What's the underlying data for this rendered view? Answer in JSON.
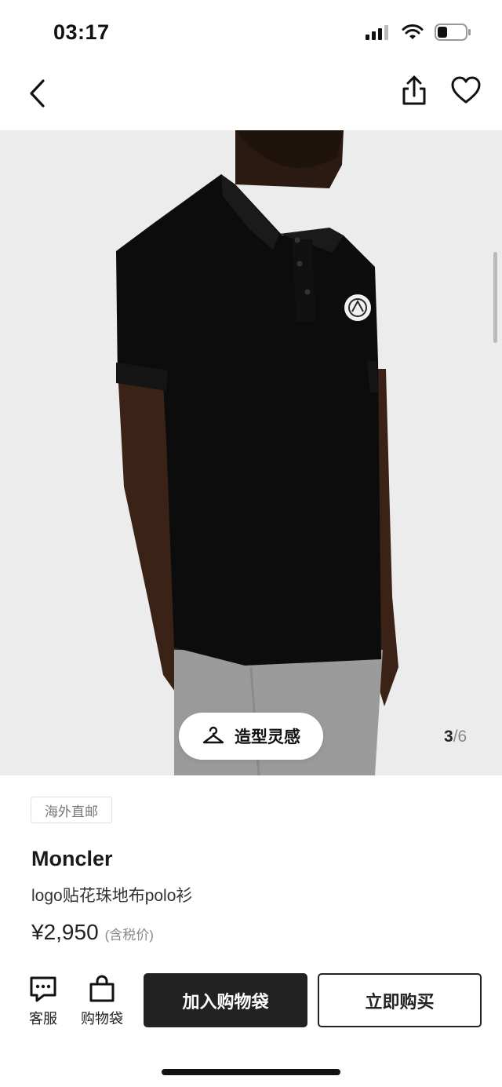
{
  "status_bar": {
    "time": "03:17",
    "icons": [
      "signal-icon",
      "wifi-icon",
      "battery-icon"
    ]
  },
  "nav": {
    "icons": [
      "back-arrow-icon",
      "share-icon",
      "heart-icon"
    ]
  },
  "gallery": {
    "styling_label": "造型灵感",
    "styling_icon": "hanger-icon",
    "current_page": "3",
    "separator": "/",
    "total_pages": "6"
  },
  "product": {
    "shipping_badge": "海外直邮",
    "brand": "Moncler",
    "name": "logo贴花珠地布polo衫",
    "price": "¥2,950",
    "tax_note": "(含税价)"
  },
  "actions": {
    "service_label": "客服",
    "service_icon": "chat-bubble-icon",
    "bag_label": "购物袋",
    "bag_icon": "shopping-bag-icon",
    "add_to_bag_label": "加入购物袋",
    "buy_now_label": "立即购买"
  },
  "colors": {
    "primary": "#222222",
    "background_image": "#ededed",
    "shirt": "#0b0b0b",
    "trousers": "#9a9a9a"
  }
}
